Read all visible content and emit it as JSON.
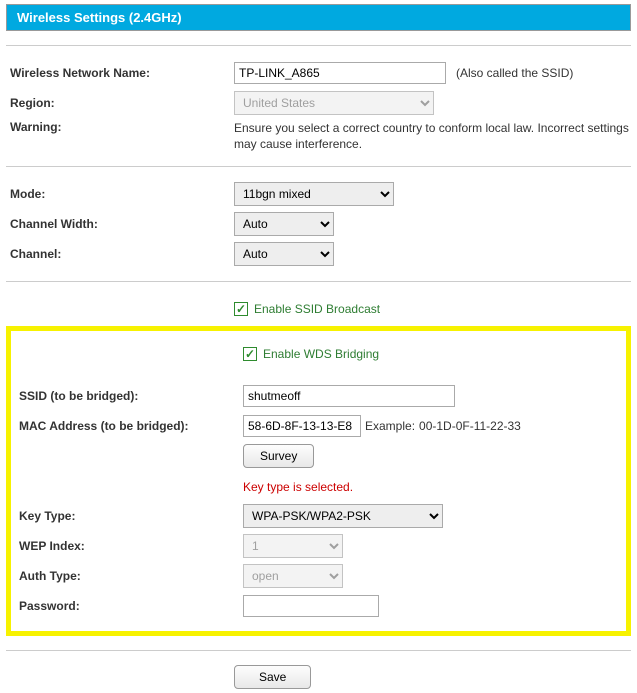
{
  "header": {
    "title": "Wireless Settings (2.4GHz)"
  },
  "network_name": {
    "label": "Wireless Network Name:",
    "value": "TP-LINK_A865",
    "appendix": "(Also called the SSID)"
  },
  "region": {
    "label": "Region:",
    "value": "United States"
  },
  "warning": {
    "label": "Warning:",
    "text": "Ensure you select a correct country to conform local law. Incorrect settings may cause interference."
  },
  "mode": {
    "label": "Mode:",
    "value": "11bgn mixed"
  },
  "channel_width": {
    "label": "Channel Width:",
    "value": "Auto"
  },
  "channel": {
    "label": "Channel:",
    "value": "Auto"
  },
  "ssid_broadcast": {
    "label": "Enable SSID Broadcast",
    "checked": true
  },
  "wds_bridging": {
    "label": "Enable WDS Bridging",
    "checked": true
  },
  "ssid_bridged": {
    "label": "SSID (to be bridged):",
    "value": "shutmeoff"
  },
  "mac_bridged": {
    "label": "MAC Address (to be bridged):",
    "value": "58-6D-8F-13-13-E8",
    "example_label": "Example:",
    "example_value": "00-1D-0F-11-22-33"
  },
  "survey": {
    "label": "Survey"
  },
  "error_msg": "Key type is selected.",
  "key_type": {
    "label": "Key Type:",
    "value": "WPA-PSK/WPA2-PSK"
  },
  "wep_index": {
    "label": "WEP Index:",
    "value": "1"
  },
  "auth_type": {
    "label": "Auth Type:",
    "value": "open"
  },
  "password": {
    "label": "Password:",
    "value": ""
  },
  "save": {
    "label": "Save"
  }
}
